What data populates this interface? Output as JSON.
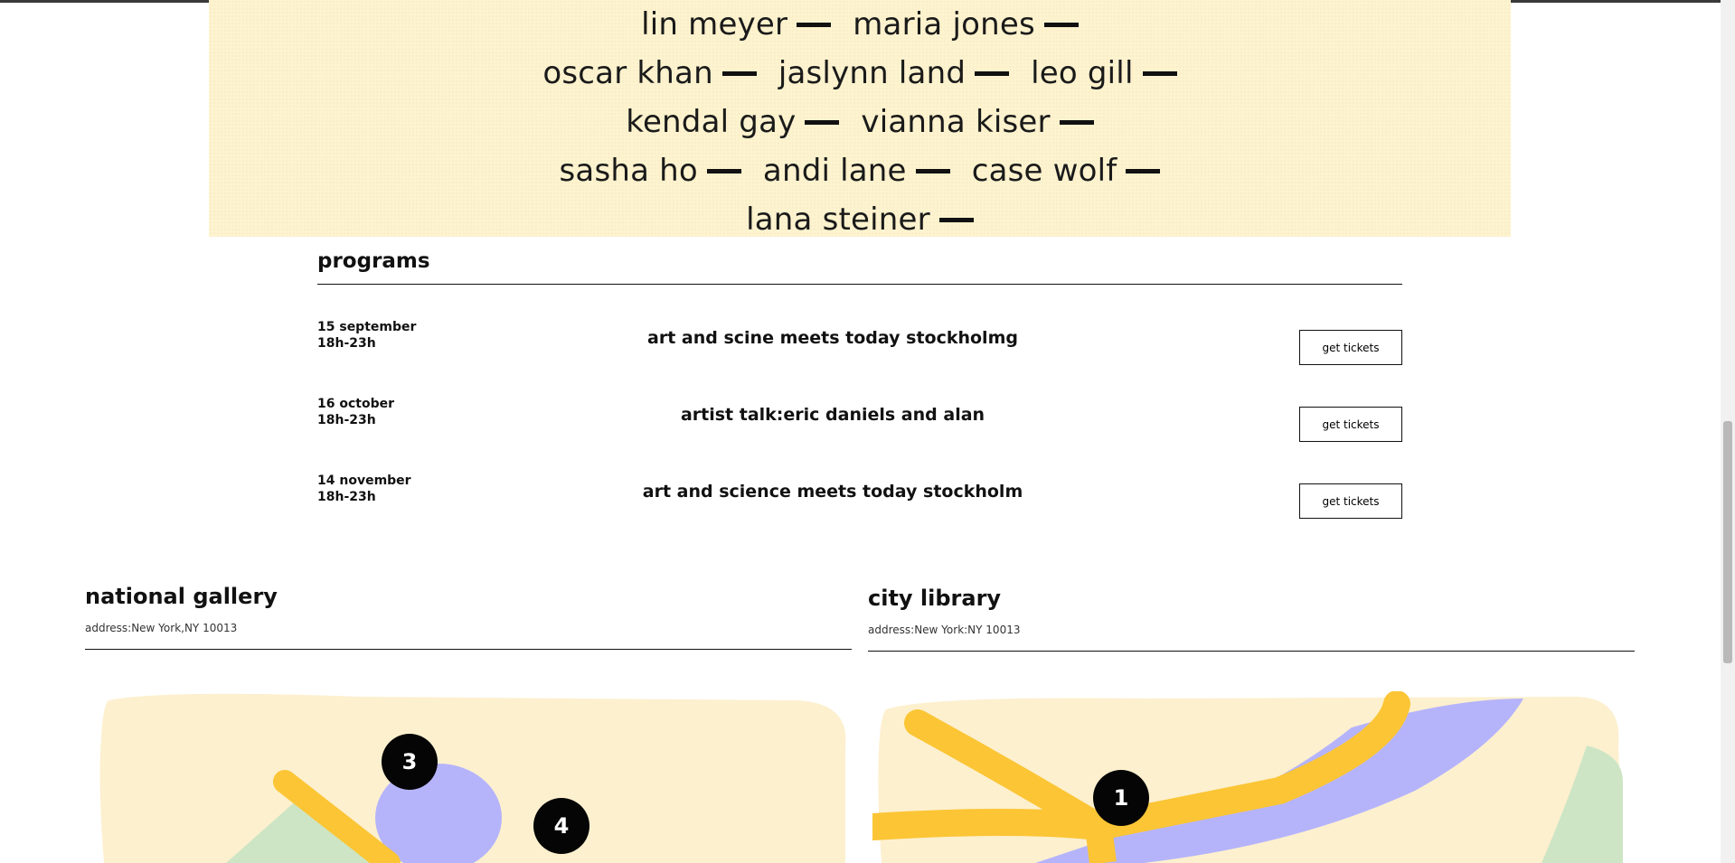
{
  "artists": [
    [
      "lin meyer",
      "maria jones"
    ],
    [
      "oscar khan",
      "jaslynn land",
      "leo gill"
    ],
    [
      "kendal gay",
      "vianna kiser"
    ],
    [
      "sasha ho",
      "andi lane",
      "case wolf"
    ],
    [
      "lana steiner"
    ]
  ],
  "programs": {
    "title": "programs",
    "items": [
      {
        "date": "15 september",
        "time": "18h-23h",
        "title": "art and scine meets today stockholmg",
        "button": "get tickets"
      },
      {
        "date": "16 october",
        "time": "18h-23h",
        "title": "artist talk:eric daniels and alan",
        "button": "get tickets"
      },
      {
        "date": "14 november",
        "time": "18h-23h",
        "title": "art and science meets today stockholm",
        "button": "get tickets"
      }
    ]
  },
  "venues": {
    "gallery": {
      "name": "national gallery",
      "address": "address:New York,NY 10013"
    },
    "library": {
      "name": "city library",
      "address": "address:New York:NY 10013"
    }
  },
  "maps": {
    "gallery_markers": [
      "3",
      "4"
    ],
    "library_markers": [
      "1"
    ],
    "colors": {
      "cream": "#fdf0cf",
      "yellow": "#fbc535",
      "lavender": "#b5b4fb",
      "green": "#cde5c4"
    }
  }
}
